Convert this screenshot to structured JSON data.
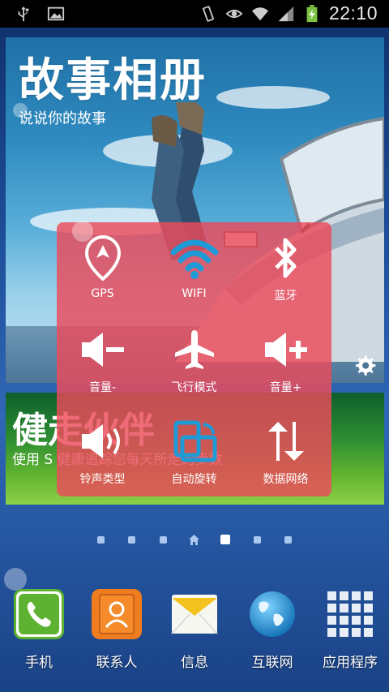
{
  "status_bar": {
    "time": "22:10",
    "icons_left": [
      "usb-icon",
      "image-icon"
    ],
    "icons_right": [
      "vibrate-icon",
      "eye-icon",
      "wifi-icon",
      "signal-icon",
      "battery-charging-icon"
    ]
  },
  "story_widget": {
    "title": "故事相册",
    "subtitle": "说说你的故事"
  },
  "health_widget": {
    "title": "健走伙伴",
    "subtitle": "使用 S 健康追踪您每天所走的步数"
  },
  "quick_settings": {
    "items": [
      {
        "label": "GPS",
        "icon": "gps-icon"
      },
      {
        "label": "WIFI",
        "icon": "wifi-icon"
      },
      {
        "label": "蓝牙",
        "icon": "bluetooth-icon"
      },
      {
        "label": "音量-",
        "icon": "volume-down-icon"
      },
      {
        "label": "飞行模式",
        "icon": "airplane-icon"
      },
      {
        "label": "音量+",
        "icon": "volume-up-icon"
      },
      {
        "label": "铃声类型",
        "icon": "ringtone-icon"
      },
      {
        "label": "自动旋转",
        "icon": "auto-rotate-icon"
      },
      {
        "label": "数据网络",
        "icon": "data-network-icon"
      }
    ],
    "colors": {
      "panel": "#eb4b5a",
      "wifi_active": "#1e9bd7"
    }
  },
  "page_indicator": {
    "count": 7,
    "home_index": 3,
    "active_index": 4
  },
  "dock": {
    "items": [
      {
        "label": "手机",
        "icon": "phone-icon"
      },
      {
        "label": "联系人",
        "icon": "contacts-icon"
      },
      {
        "label": "信息",
        "icon": "messages-icon"
      },
      {
        "label": "互联网",
        "icon": "internet-icon"
      },
      {
        "label": "应用程序",
        "icon": "apps-icon"
      }
    ]
  }
}
